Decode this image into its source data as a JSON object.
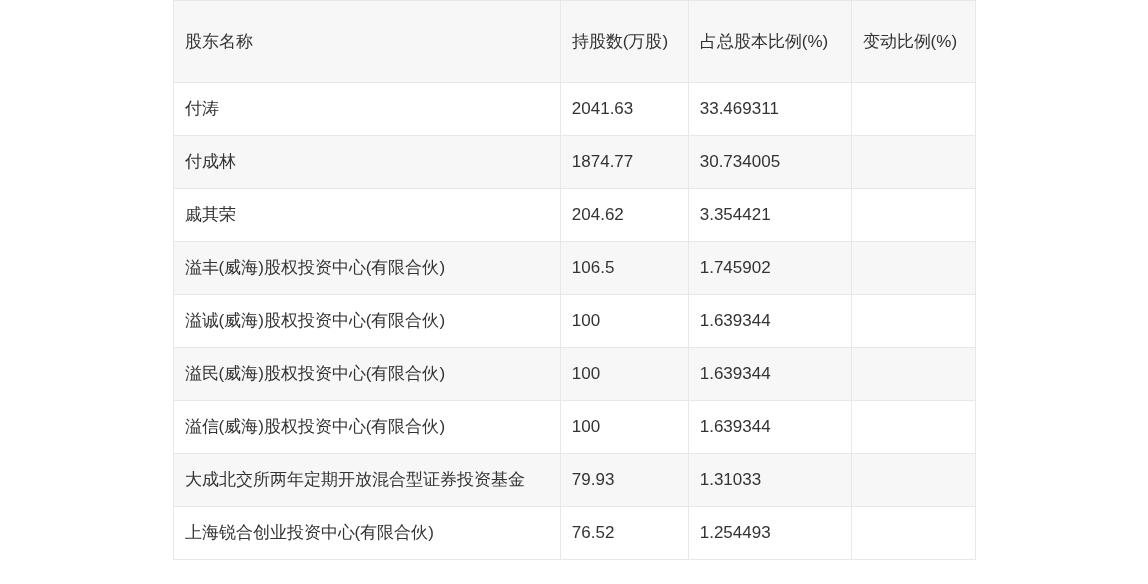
{
  "table": {
    "columns": [
      "股东名称",
      "持股数(万股)",
      "占总股本比例(%)",
      "变动比例(%)"
    ],
    "rows": [
      {
        "cells": [
          "付涛",
          "2041.63",
          "33.469311"
        ]
      },
      {
        "cells": [
          "付成林",
          "1874.77",
          "30.734005"
        ]
      },
      {
        "cells": [
          "戚其荣",
          "204.62",
          "3.354421"
        ]
      },
      {
        "cells": [
          "溢丰(威海)股权投资中心(有限合伙)",
          "106.5",
          "1.745902"
        ]
      },
      {
        "cells": [
          "溢诚(威海)股权投资中心(有限合伙)",
          "100",
          "1.639344"
        ]
      },
      {
        "cells": [
          "溢民(威海)股权投资中心(有限合伙)",
          "100",
          "1.639344"
        ]
      },
      {
        "cells": [
          "溢信(威海)股权投资中心(有限合伙)",
          "100",
          "1.639344"
        ]
      },
      {
        "cells": [
          "大成北交所两年定期开放混合型证券投资基金",
          "79.93",
          "1.31033"
        ]
      },
      {
        "cells": [
          "上海锐合创业投资中心(有限合伙)",
          "76.52",
          "1.254493"
        ]
      }
    ]
  }
}
